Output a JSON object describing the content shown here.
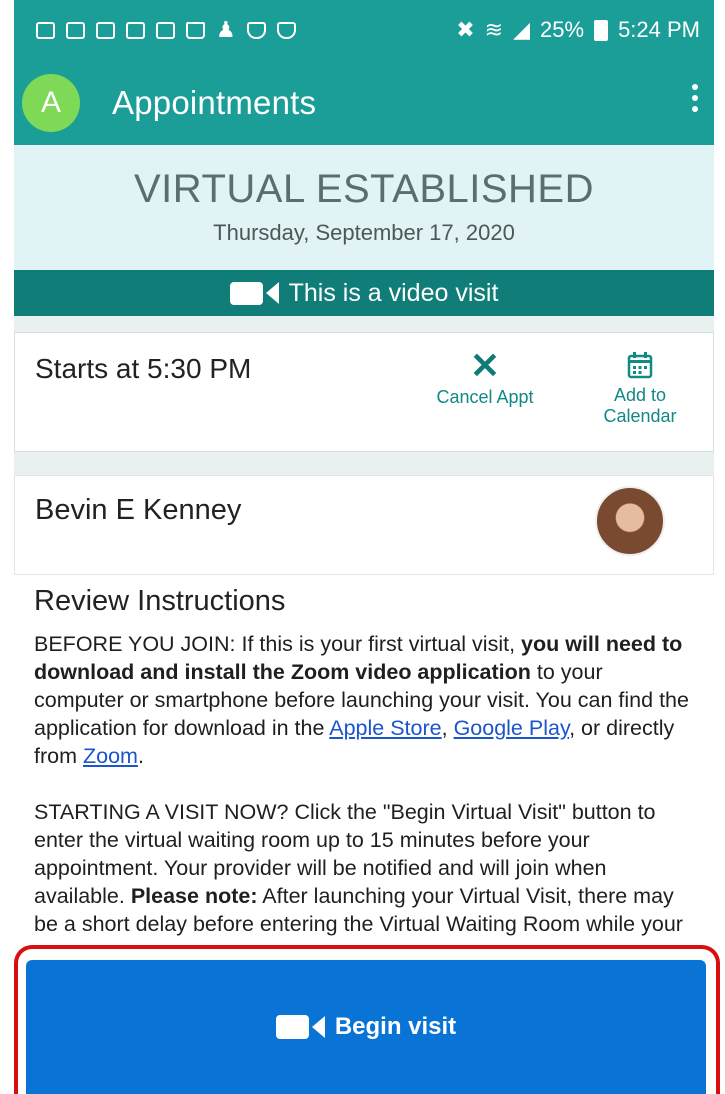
{
  "status_bar": {
    "notification_icons": [
      "image-icon",
      "mail-icon",
      "mail-icon",
      "sim-icon",
      "gallery-icon",
      "bag-icon",
      "person-icon",
      "shield-icon",
      "shield-icon"
    ],
    "battery": "25%",
    "time": "5:24 PM"
  },
  "app_bar": {
    "avatar_letter": "A",
    "title": "Appointments"
  },
  "appointment": {
    "type": "VIRTUAL ESTABLISHED",
    "date": "Thursday, September 17, 2020",
    "video_banner": "This is a video visit",
    "starts": "Starts at 5:30 PM",
    "cancel_label": "Cancel Appt",
    "add_calendar_label_1": "Add to",
    "add_calendar_label_2": "Calendar"
  },
  "provider": {
    "name": "Bevin E Kenney"
  },
  "instructions": {
    "title": "Review Instructions",
    "p1_a": "BEFORE YOU JOIN: If this is your first virtual visit, ",
    "p1_bold": "you will need to download and install the Zoom video application",
    "p1_b": " to your computer or smartphone before launching your visit. You can find the application for download in the ",
    "link_apple": "Apple Store",
    "p1_c": ", ",
    "link_google": "Google Play",
    "p1_d": ", or directly from ",
    "link_zoom": "Zoom",
    "p1_e": ".",
    "p2_a": "STARTING A VISIT NOW? Click the \"Begin Virtual Visit\" button to enter the virtual waiting room up to 15 minutes before your appointment. Your provider will be notified and will join when available. ",
    "p2_bold": "Please note:",
    "p2_b": " After launching your Virtual Visit, there may be a short delay before entering the Virtual Waiting Room while your"
  },
  "begin_button": {
    "label": "Begin visit"
  },
  "colors": {
    "app_bar": "#1c9e98",
    "header_bg": "#e1f3f5",
    "video_banner": "#117d78",
    "accent_teal": "#118a84",
    "begin_button": "#0974d6",
    "highlight_border": "#d90f0f"
  }
}
